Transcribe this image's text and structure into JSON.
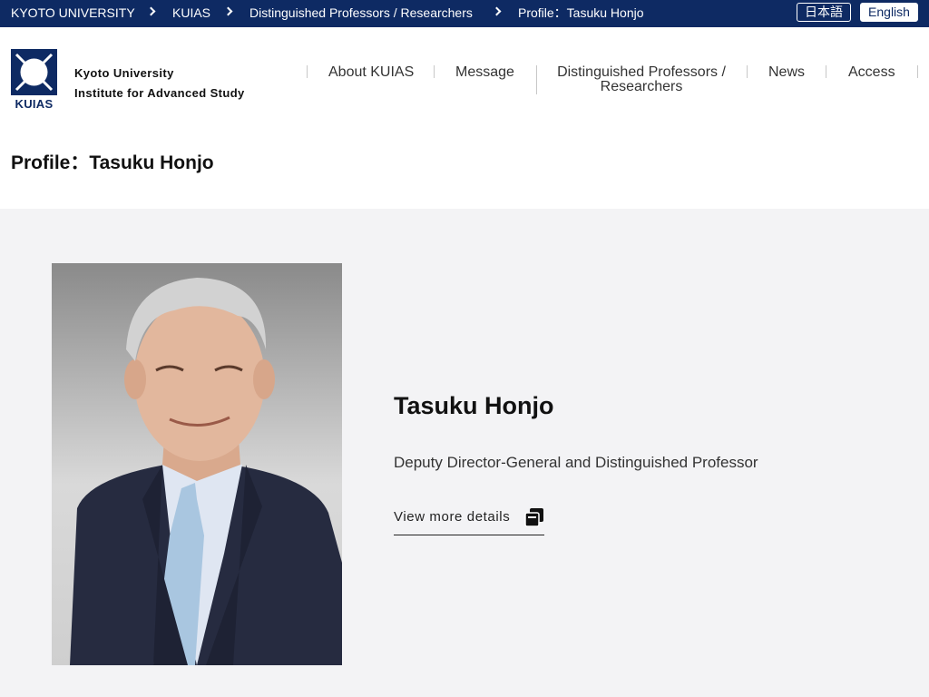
{
  "breadcrumb": {
    "items": [
      "KYOTO UNIVERSITY",
      "KUIAS",
      "Distinguished Professors / Researchers",
      "Profile：Tasuku Honjo"
    ]
  },
  "language": {
    "japanese": "日本語",
    "english": "English"
  },
  "header": {
    "logo_text": "KUIAS",
    "institution_line1": "Kyoto University",
    "institution_line2": "Institute for Advanced Study"
  },
  "nav": {
    "about": "About KUIAS",
    "message": "Message",
    "professors_line1": "Distinguished Professors /",
    "professors_line2": "Researchers",
    "news": "News",
    "access": "Access"
  },
  "page": {
    "title": "Profile：Tasuku Honjo"
  },
  "profile": {
    "name": "Tasuku Honjo",
    "position": "Deputy Director-General and Distinguished Professor",
    "details_link": "View more details",
    "details_icon": "external-window-icon"
  },
  "colors": {
    "brand_navy": "#0e2a63",
    "content_bg": "#f3f3f5"
  }
}
